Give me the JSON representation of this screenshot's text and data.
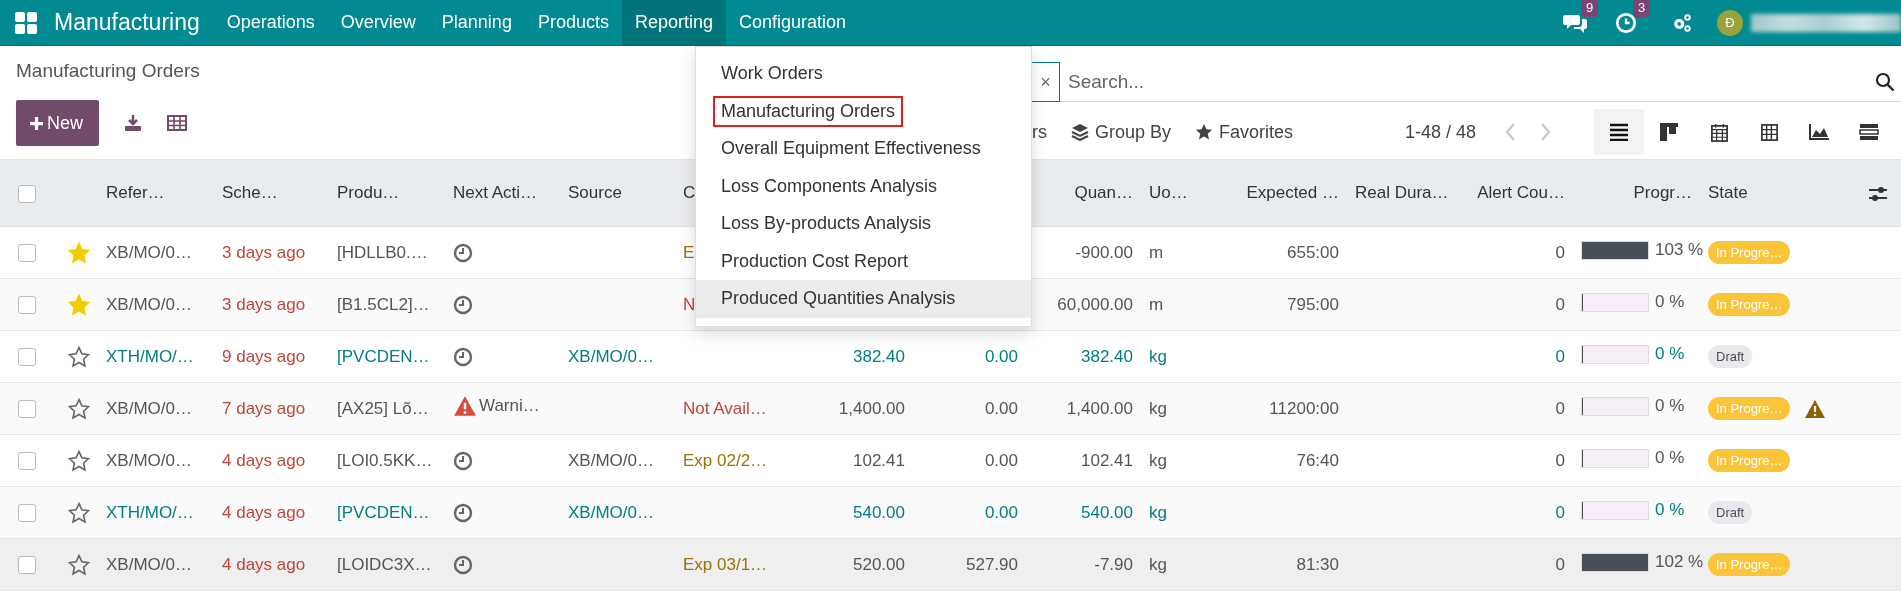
{
  "navbar": {
    "app_name": "Manufacturing",
    "menu": [
      {
        "label": "Operations",
        "selected": false
      },
      {
        "label": "Overview",
        "selected": false
      },
      {
        "label": "Planning",
        "selected": false
      },
      {
        "label": "Products",
        "selected": false
      },
      {
        "label": "Reporting",
        "selected": true
      },
      {
        "label": "Configuration",
        "selected": false
      }
    ],
    "messages_badge": "9",
    "activities_badge": "3",
    "avatar_initial": "Đ"
  },
  "breadcrumb": "Manufacturing Orders",
  "new_button": "New",
  "search": {
    "facet_remove": "×",
    "placeholder": "Search..."
  },
  "filters": [
    {
      "label": "rs",
      "kind": "filter"
    },
    {
      "label": "Group By",
      "kind": "group"
    },
    {
      "label": "Favorites",
      "kind": "favorite"
    }
  ],
  "pager": "1-48 / 48",
  "views": [
    {
      "kind": "list",
      "selected": true
    },
    {
      "kind": "kanban",
      "selected": false
    },
    {
      "kind": "calendar",
      "selected": false
    },
    {
      "kind": "pivot",
      "selected": false
    },
    {
      "kind": "graph",
      "selected": false
    },
    {
      "kind": "gantt",
      "selected": false
    }
  ],
  "table": {
    "select_all_checked": false,
    "columns": [
      {
        "label": "Refer…",
        "kind": "text"
      },
      {
        "label": "Sche…",
        "kind": "text"
      },
      {
        "label": "Produ…",
        "kind": "text"
      },
      {
        "label": "Next Acti…",
        "kind": "text"
      },
      {
        "label": "Source",
        "kind": "text"
      },
      {
        "label": "C",
        "kind": "text"
      },
      {
        "kind": "number"
      },
      {
        "kind": "number"
      },
      {
        "label": "Quan…",
        "kind": "number"
      },
      {
        "label": "Uo…",
        "kind": "text"
      },
      {
        "label": "Expected …",
        "kind": "number"
      },
      {
        "label": "Real Dura…",
        "kind": "text"
      },
      {
        "label": "Alert Cou…",
        "kind": "number"
      },
      {
        "label": "Progr…",
        "kind": "number"
      },
      {
        "label": "State",
        "kind": "text"
      }
    ],
    "rows": [
      {
        "starred": true,
        "hovered": false,
        "reference": "XB/MO/0…",
        "scheduled": "3 days ago",
        "product": "[HDLLB0.…",
        "activity": {
          "kind": "clock"
        },
        "components": {
          "text": "E",
          "color": "#9a7300"
        },
        "quantity": "-900.00",
        "uom": "m",
        "expected": "655:00",
        "alert_count": "0",
        "progress": {
          "level": 1,
          "text": "103 %"
        },
        "state": {
          "kind": "in_progress",
          "label": "In Progre…"
        },
        "alert": false
      },
      {
        "starred": true,
        "hovered": false,
        "reference": "XB/MO/0…",
        "scheduled": "3 days ago",
        "product": "[B1.5CL2]…",
        "activity": {
          "kind": "clock"
        },
        "components": {
          "text": "N",
          "color": "#c0453a"
        },
        "quantity": "60,000.00",
        "uom": "m",
        "expected": "795:00",
        "alert_count": "0",
        "progress": {
          "level": 0,
          "text": "0 %"
        },
        "state": {
          "kind": "in_progress",
          "label": "In Progre…"
        },
        "alert": false
      },
      {
        "starred": false,
        "hovered": false,
        "reference": "XTH/MO/…",
        "scheduled": "9 days ago",
        "product": "[PVCDEN…",
        "activity": {
          "kind": "clock"
        },
        "source": "XB/MO/0…",
        "column_8": "382.40",
        "column_9": "0.00",
        "quantity": "382.40",
        "uom": "kg",
        "alert_count": "0",
        "progress": {
          "level": 0,
          "text": "0 %"
        },
        "state": {
          "kind": "draft",
          "label": "Draft"
        },
        "alert": false
      },
      {
        "starred": false,
        "hovered": false,
        "reference": "XB/MO/0…",
        "scheduled": "7 days ago",
        "product": "[AX25] Lõ…",
        "activity": {
          "kind": "warning",
          "text": "Warni…"
        },
        "components": {
          "text": "Not Avail…",
          "color": "#c0453a"
        },
        "column_8": "1,400.00",
        "column_9": "0.00",
        "quantity": "1,400.00",
        "uom": "kg",
        "expected": "11200:00",
        "alert_count": "0",
        "progress": {
          "level": 0,
          "text": "0 %"
        },
        "state": {
          "kind": "in_progress",
          "label": "In Progre…"
        },
        "alert": true
      },
      {
        "starred": false,
        "hovered": false,
        "reference": "XB/MO/0…",
        "scheduled": "4 days ago",
        "product": "[LOI0.5KK…",
        "activity": {
          "kind": "clock"
        },
        "source": "XB/MO/0…",
        "components": {
          "text": "Exp 02/2…",
          "color": "#9a7300"
        },
        "column_8": "102.41",
        "column_9": "0.00",
        "quantity": "102.41",
        "uom": "kg",
        "expected": "76:40",
        "alert_count": "0",
        "progress": {
          "level": 0,
          "text": "0 %"
        },
        "state": {
          "kind": "in_progress",
          "label": "In Progre…"
        },
        "alert": false
      },
      {
        "starred": false,
        "hovered": false,
        "reference": "XTH/MO/…",
        "scheduled": "4 days ago",
        "product": "[PVCDEN…",
        "activity": {
          "kind": "clock"
        },
        "source": "XB/MO/0…",
        "column_8": "540.00",
        "column_9": "0.00",
        "quantity": "540.00",
        "uom": "kg",
        "alert_count": "0",
        "progress": {
          "level": 0,
          "text": "0 %"
        },
        "state": {
          "kind": "draft",
          "label": "Draft"
        },
        "alert": false
      },
      {
        "starred": false,
        "hovered": true,
        "reference": "XB/MO/0…",
        "scheduled": "4 days ago",
        "product": "[LOIDC3X…",
        "activity": {
          "kind": "clock"
        },
        "components": {
          "text": "Exp 03/1…",
          "color": "#9a7300"
        },
        "column_8": "520.00",
        "column_9": "527.90",
        "quantity": "-7.90",
        "uom": "kg",
        "expected": "81:30",
        "alert_count": "0",
        "progress": {
          "level": 1,
          "text": "102 %"
        },
        "state": {
          "kind": "in_progress",
          "label": "In Progre…"
        },
        "alert": false
      }
    ]
  },
  "reporting_menu": [
    {
      "label": "Work Orders",
      "outlined": false,
      "hovered": false
    },
    {
      "label": "Manufacturing Orders",
      "outlined": true,
      "hovered": false
    },
    {
      "label": "Overall Equipment Effectiveness",
      "outlined": false,
      "hovered": false
    },
    {
      "label": "Loss Components Analysis",
      "outlined": false,
      "hovered": false
    },
    {
      "label": "Loss By-products Analysis",
      "outlined": false,
      "hovered": false
    },
    {
      "label": "Production Cost Report",
      "outlined": false,
      "hovered": false
    },
    {
      "label": "Produced Quantities Analysis",
      "outlined": false,
      "hovered": true
    }
  ]
}
